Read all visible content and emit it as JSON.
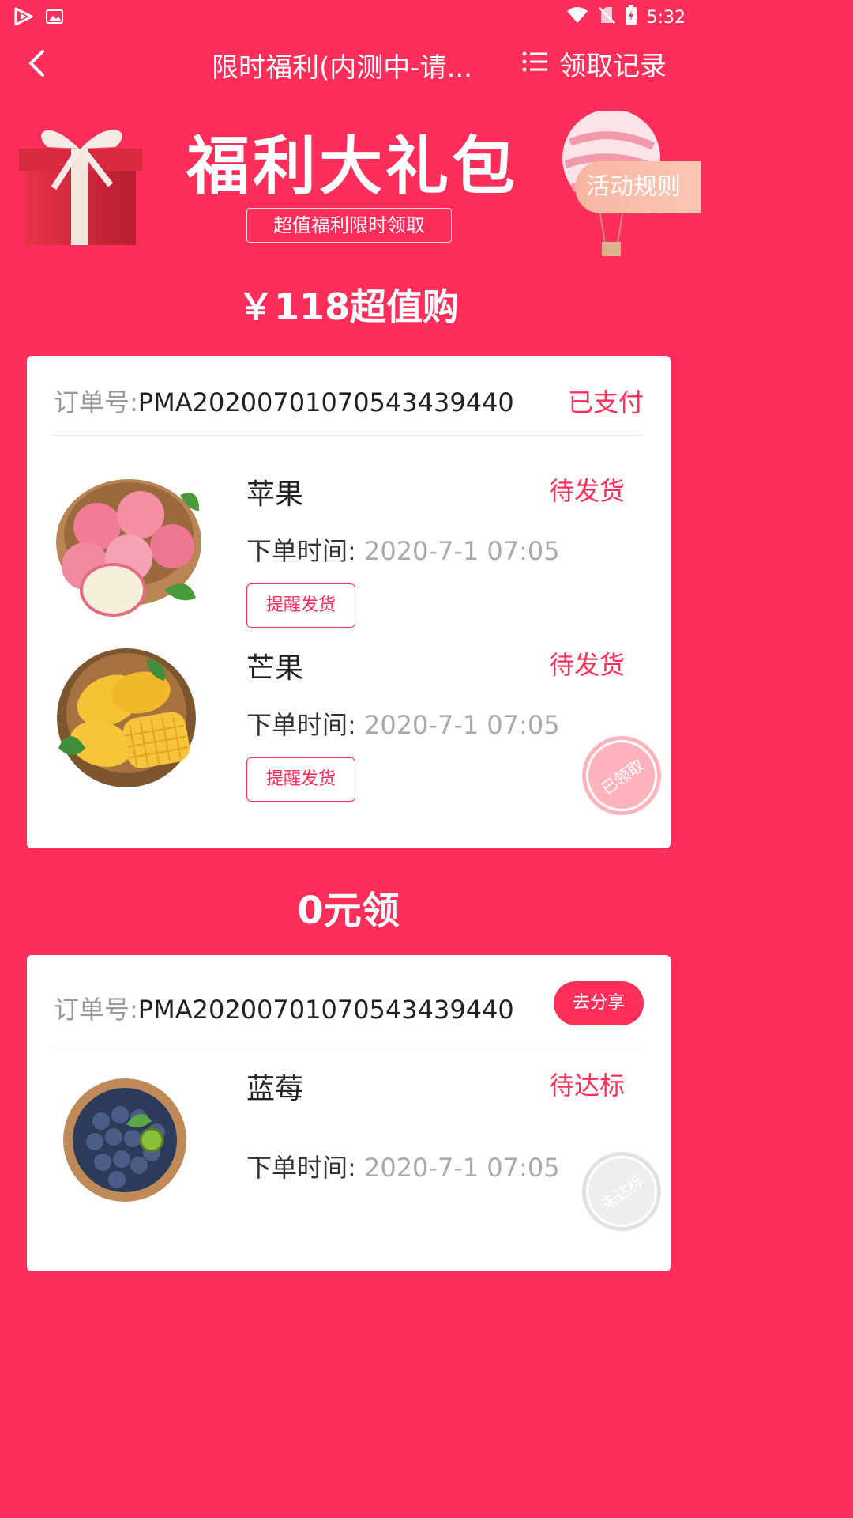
{
  "status_bar": {
    "time": "5:32",
    "icons": [
      "app-logo-icon",
      "image-icon",
      "wifi-icon",
      "no-sim-icon",
      "battery-charging-icon"
    ]
  },
  "nav": {
    "title": "限时福利(内测中-请...",
    "records_label": "领取记录"
  },
  "hero": {
    "title": "福利大礼包",
    "subtitle": "超值福利限时领取",
    "rules_label": "活动规则"
  },
  "sections": [
    {
      "title": "￥118超值购",
      "order": {
        "label": "订单号:",
        "number": "PMA20200701070543439440",
        "status": "已支付"
      },
      "items": [
        {
          "name": "苹果",
          "status": "待发货",
          "time_label": "下单时间:",
          "time_value": "2020-7-1 07:05",
          "button": "提醒发货"
        },
        {
          "name": "芒果",
          "status": "待发货",
          "time_label": "下单时间:",
          "time_value": "2020-7-1 07:05",
          "button": "提醒发货"
        }
      ],
      "stamp": "已领取"
    },
    {
      "title": "0元领",
      "order": {
        "label": "订单号:",
        "number": "PMA20200701070543439440",
        "action": "去分享"
      },
      "items": [
        {
          "name": "蓝莓",
          "status": "待达标",
          "time_label": "下单时间:",
          "time_value": "2020-7-1 07:05"
        }
      ],
      "stamp": "未达标"
    }
  ],
  "colors": {
    "primary": "#fe2e5b",
    "accent_text": "#ff2f5a",
    "muted": "#999999"
  }
}
